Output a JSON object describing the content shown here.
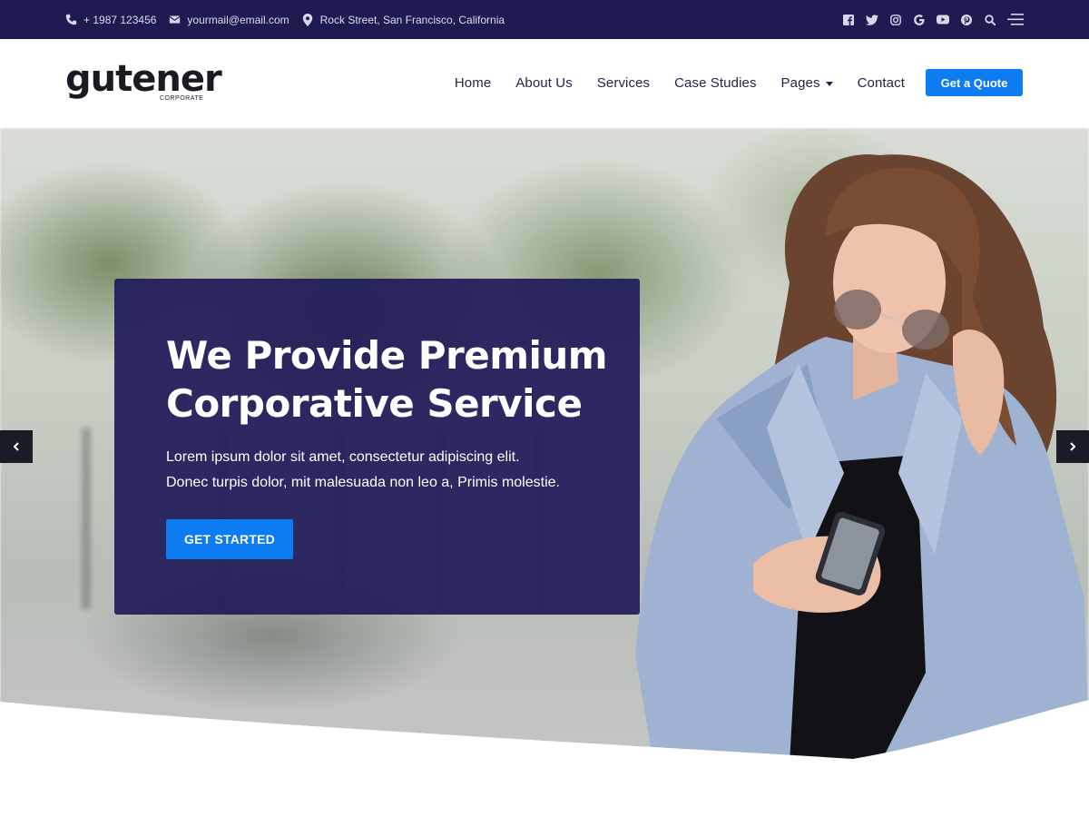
{
  "topbar": {
    "phone": "+ 1987 123456",
    "email": "yourmail@email.com",
    "address": "Rock Street, San Francisco, California",
    "social_icons": [
      "facebook-icon",
      "twitter-icon",
      "instagram-icon",
      "google-icon",
      "youtube-icon",
      "pinterest-icon",
      "search-icon",
      "menu-icon"
    ]
  },
  "header": {
    "logo_word": "gutener",
    "logo_sub": "CORPORATE",
    "nav": [
      {
        "label": "Home"
      },
      {
        "label": "About Us"
      },
      {
        "label": "Services"
      },
      {
        "label": "Case Studies"
      },
      {
        "label": "Pages"
      },
      {
        "label": "Contact"
      }
    ],
    "cta": "Get a Quote"
  },
  "hero": {
    "title_line1": "We Provide Premium",
    "title_line2": "Corporative Service",
    "text_line1": "Lorem ipsum dolor sit amet, consectetur adipiscing elit.",
    "text_line2": "Donec turpis dolor, mit malesuada non leo a, Primis molestie.",
    "button": "GET STARTED"
  },
  "colors": {
    "topbar_bg": "#1f1b52",
    "accent": "#0d7bf2",
    "hero_box": "#201c5a",
    "nav_text": "#222645"
  }
}
